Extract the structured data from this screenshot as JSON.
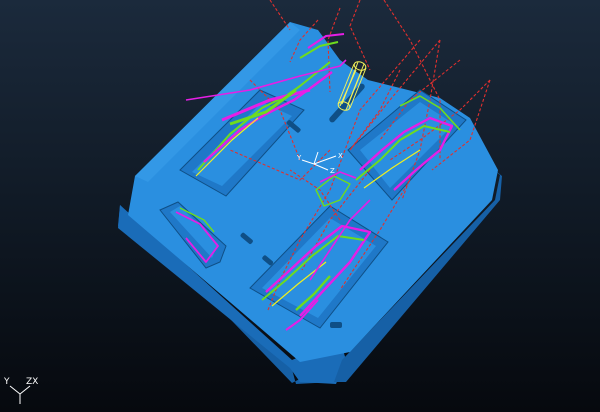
{
  "viewport": {
    "background_top": "#1b2a3c",
    "background_bottom": "#06090e"
  },
  "model": {
    "fill_color": "#2a8fe0",
    "side_color": "#1e76c4",
    "dark_side_color": "#1660a6",
    "toolpath_colors": {
      "rapid": "#e0302e",
      "cut_primary": "#e61ee6",
      "cut_secondary": "#6edc1e",
      "cut_tertiary": "#f0f01e"
    }
  },
  "tool": {
    "icon": "cutter-tool-icon",
    "color": "#f2f25a"
  },
  "workplane_triad": {
    "icon": "workplane-axis-icon",
    "y_label": "Y",
    "x_label": "X",
    "z_label": "Z"
  },
  "view_triad": {
    "icon": "view-orientation-icon",
    "y_label": "Y",
    "zx_label": "ZX"
  }
}
